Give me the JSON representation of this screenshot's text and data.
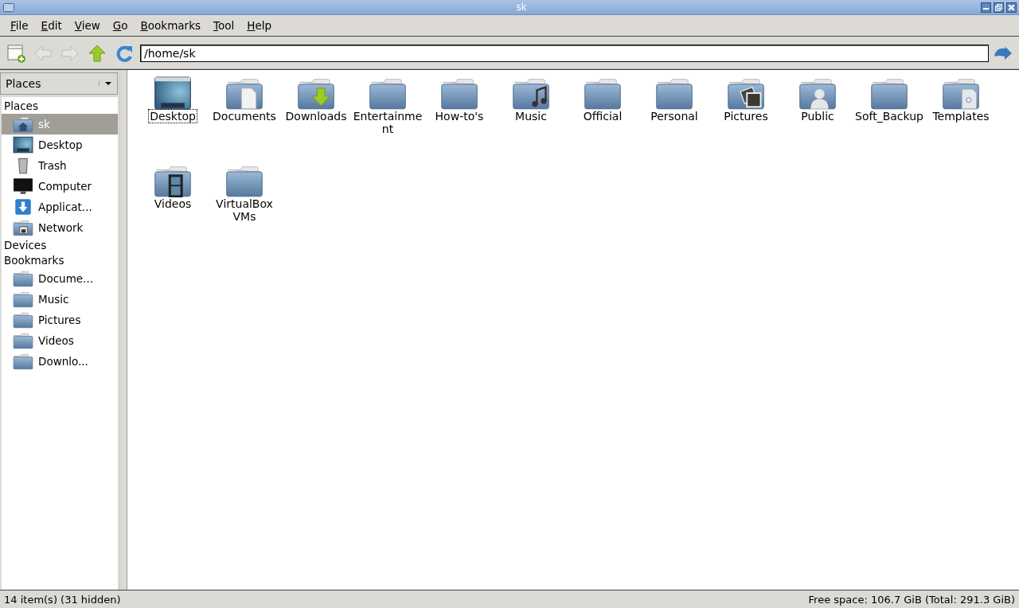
{
  "window": {
    "title": "sk"
  },
  "menu": [
    "File",
    "Edit",
    "View",
    "Go",
    "Bookmarks",
    "Tool",
    "Help"
  ],
  "location": {
    "value": "/home/sk"
  },
  "sidebar": {
    "mode": "Places",
    "sections": [
      {
        "title": "Places",
        "items": [
          {
            "label": "sk",
            "kind": "home",
            "selected": true
          },
          {
            "label": "Desktop",
            "kind": "desktop",
            "selected": false
          },
          {
            "label": "Trash",
            "kind": "trash",
            "selected": false
          },
          {
            "label": "Computer",
            "kind": "computer",
            "selected": false
          },
          {
            "label": "Applicat...",
            "kind": "applications",
            "selected": false
          },
          {
            "label": "Network",
            "kind": "network",
            "selected": false
          }
        ]
      },
      {
        "title": "Devices"
      },
      {
        "title": "Bookmarks",
        "items": [
          {
            "label": "Docume...",
            "kind": "folder",
            "selected": false
          },
          {
            "label": "Music",
            "kind": "folder",
            "selected": false
          },
          {
            "label": "Pictures",
            "kind": "folder",
            "selected": false
          },
          {
            "label": "Videos",
            "kind": "folder",
            "selected": false
          },
          {
            "label": "Downlo...",
            "kind": "folder",
            "selected": false
          }
        ]
      }
    ]
  },
  "files": [
    {
      "name": "Desktop",
      "kind": "desktop",
      "focused": true
    },
    {
      "name": "Documents",
      "kind": "documents",
      "focused": false
    },
    {
      "name": "Downloads",
      "kind": "downloads",
      "focused": false
    },
    {
      "name": "Entertainment",
      "kind": "folder",
      "focused": false
    },
    {
      "name": "How-to's",
      "kind": "folder",
      "focused": false
    },
    {
      "name": "Music",
      "kind": "music",
      "focused": false
    },
    {
      "name": "Official",
      "kind": "folder",
      "focused": false
    },
    {
      "name": "Personal",
      "kind": "folder",
      "focused": false
    },
    {
      "name": "Pictures",
      "kind": "pictures",
      "focused": false
    },
    {
      "name": "Public",
      "kind": "public",
      "focused": false
    },
    {
      "name": "Soft_Backup",
      "kind": "folder",
      "focused": false
    },
    {
      "name": "Templates",
      "kind": "templates",
      "focused": false
    },
    {
      "name": "Videos",
      "kind": "videos",
      "focused": false
    },
    {
      "name": "VirtualBox VMs",
      "kind": "folder",
      "focused": false
    }
  ],
  "status_bar": {
    "left": "14 item(s) (31 hidden)",
    "right": "Free space: 106.7 GiB (Total: 291.3 GiB)"
  }
}
